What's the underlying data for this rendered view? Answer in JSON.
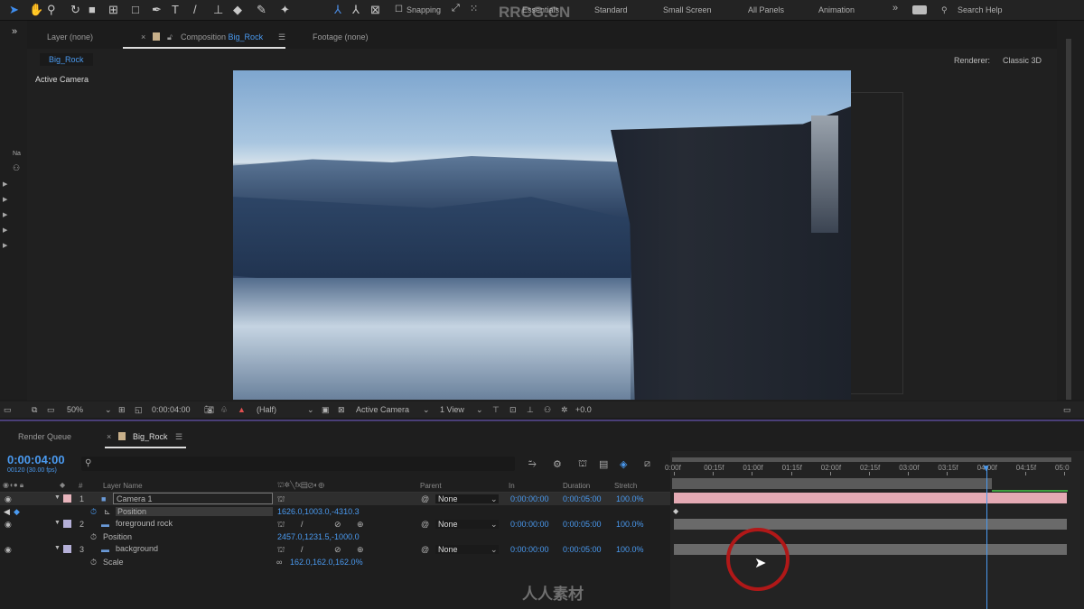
{
  "toolbar": {
    "snapping_label": "Snapping",
    "workspaces": [
      "Essentials",
      "Standard",
      "Small Screen",
      "All Panels",
      "Animation"
    ],
    "more": "»",
    "search_placeholder": "Search Help"
  },
  "watermark": {
    "top": "RRCG.CN",
    "bottom": "人人素材"
  },
  "panels": {
    "collapse": "»",
    "layer_tab": "Layer (none)",
    "comp_tab_prefix": "Composition",
    "comp_name": "Big_Rock",
    "footage_tab": "Footage (none)",
    "breadcrumb": "Big_Rock",
    "view_label": "Active Camera",
    "renderer_label": "Renderer:",
    "renderer_value": "Classic 3D"
  },
  "viewer_footer": {
    "zoom": "50%",
    "timecode": "0:00:04:00",
    "resolution": "(Half)",
    "camera": "Active Camera",
    "views": "1 View",
    "exposure": "+0.0"
  },
  "timeline": {
    "tabs": [
      "Render Queue",
      "Big_Rock"
    ],
    "timecode": "0:00:04:00",
    "frame_info": "00120 (30.00 fps)",
    "columns": {
      "num": "#",
      "layer_name": "Layer Name",
      "parent": "Parent",
      "in": "In",
      "duration": "Duration",
      "stretch": "Stretch"
    },
    "layers": [
      {
        "num": "1",
        "name": "Camera 1",
        "color": "#e8b4bc",
        "parent": "None",
        "in": "0:00:00:00",
        "duration": "0:00:05:00",
        "stretch": "100.0%",
        "prop": "Position",
        "prop_value": "1626.0,1003.0,-4310.3"
      },
      {
        "num": "2",
        "name": "foreground rock",
        "color": "#b5b0d8",
        "parent": "None",
        "in": "0:00:00:00",
        "duration": "0:00:05:00",
        "stretch": "100.0%",
        "prop": "Position",
        "prop_value": "2457.0,1231.5,-1000.0"
      },
      {
        "num": "3",
        "name": "background",
        "color": "#b5b0d8",
        "parent": "None",
        "in": "0:00:00:00",
        "duration": "0:00:05:00",
        "stretch": "100.0%",
        "prop": "Scale",
        "prop_value": "162.0,162.0,162.0%"
      }
    ],
    "ruler": [
      "0:00f",
      "00:15f",
      "01:00f",
      "01:15f",
      "02:00f",
      "02:15f",
      "03:00f",
      "03:15f",
      "04:00f",
      "04:15f",
      "05:0"
    ],
    "playhead_seconds": 4,
    "duration_seconds": 5,
    "colors": {
      "accent": "#4a9af0",
      "camera_bar": "#e8b4bc",
      "layer_bar": "#6a6a6a"
    }
  }
}
